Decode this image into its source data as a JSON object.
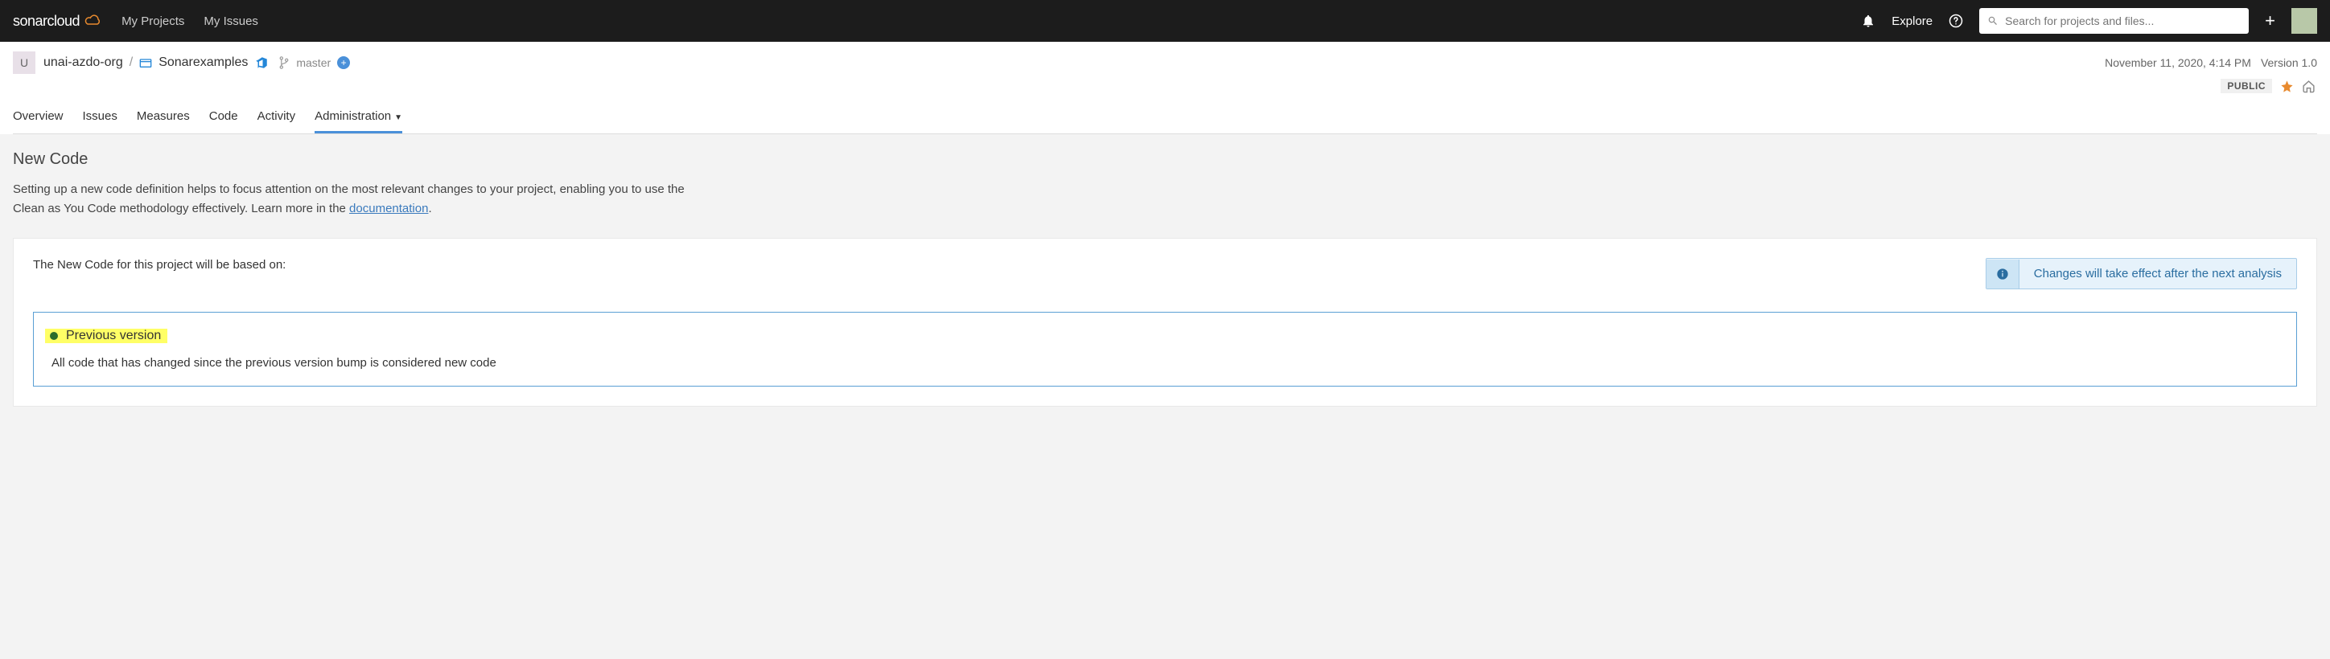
{
  "header": {
    "logo_text": "sonarcloud",
    "nav": [
      "My Projects",
      "My Issues"
    ],
    "explore": "Explore",
    "search_placeholder": "Search for projects and files..."
  },
  "breadcrumb": {
    "org_initial": "U",
    "org_name": "unai-azdo-org",
    "project_name": "Sonarexamples",
    "branch": "master",
    "timestamp": "November 11, 2020, 4:14 PM",
    "version": "Version 1.0",
    "visibility": "PUBLIC"
  },
  "tabs": [
    "Overview",
    "Issues",
    "Measures",
    "Code",
    "Activity",
    "Administration"
  ],
  "active_tab": "Administration",
  "page": {
    "title": "New Code",
    "description_pre": "Setting up a new code definition helps to focus attention on the most relevant changes to your project, enabling you to use the Clean as You Code methodology effectively. Learn more in the ",
    "doc_link": "documentation",
    "description_post": "."
  },
  "panel": {
    "intro": "The New Code for this project will be based on:",
    "alert": "Changes will take effect after the next analysis",
    "option_title": "Previous version",
    "option_desc": "All code that has changed since the previous version bump is considered new code"
  }
}
